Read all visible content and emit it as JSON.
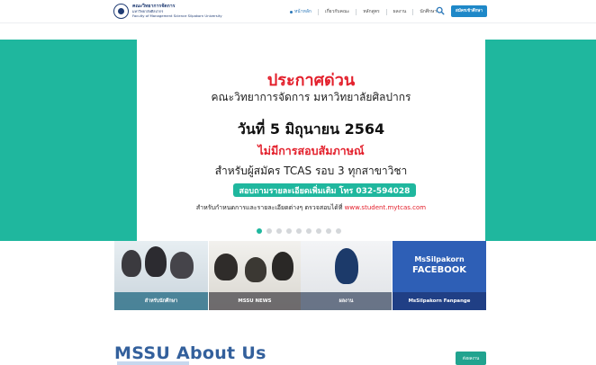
{
  "header": {
    "logo_line1": "คณะวิทยาการจัดการ",
    "logo_line2": "มหาวิทยาลัยศิลปากร",
    "logo_line3": "Faculty of Management Science Silpakorn University",
    "nav": [
      {
        "label": "หน้าหลัก",
        "active": true
      },
      {
        "label": "เกี่ยวกับคณะ",
        "active": false
      },
      {
        "label": "หลักสูตร",
        "active": false
      },
      {
        "label": "ผลงาน",
        "active": false
      },
      {
        "label": "นักศึกษา",
        "active": false
      }
    ],
    "search_icon": "search-icon",
    "cta_label": "สมัครเข้าศึกษา"
  },
  "hero": {
    "title": "ประกาศด่วน",
    "subtitle": "คณะวิทยาการจัดการ มหาวิทยาลัยศิลปากร",
    "date": "วันที่ 5 มิถุนายน 2564",
    "notice": "ไม่มีการสอบสัมภาษณ์",
    "tcas": "สำหรับผู้สมัคร TCAS รอบ 3 ทุกสาขาวิชา",
    "phone": "สอบถามรายละเอียดเพิ่มเติม โทร 032-594028",
    "note_text": "สำหรับกำหนดการและรายละเอียดต่างๆ ตรวจสอบได้ที่",
    "note_url": "www.student.mytcas.com",
    "slides_total": 9,
    "active_slide": 1,
    "accent_color": "#1fb79e",
    "alert_color": "#e3202c"
  },
  "tiles": [
    {
      "label": "สำหรับนักศึกษา"
    },
    {
      "label": "MSSU NEWS"
    },
    {
      "label": "ผลงาน"
    },
    {
      "label": "MsSilpakorn Fanpange",
      "fb_title_1": "MsSilpakorn",
      "fb_title_2": "FACEBOOK"
    }
  ],
  "about": {
    "title": "MSSU About Us",
    "button": "ดังผลงาน"
  }
}
